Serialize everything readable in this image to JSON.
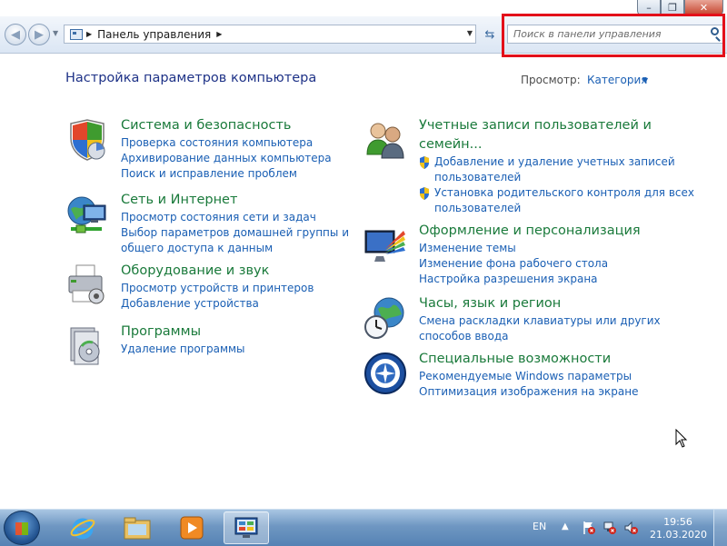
{
  "window": {
    "address_path": "Панель управления",
    "search_placeholder": "Поиск в панели управления",
    "caption_min": "–",
    "caption_max": "❐",
    "caption_close": "✕"
  },
  "header": {
    "title": "Настройка параметров компьютера",
    "view_label": "Просмотр:",
    "view_value": "Категория"
  },
  "categories_left": [
    {
      "icon": "shield-icon",
      "title": "Система и безопасность",
      "links": [
        "Проверка состояния компьютера",
        "Архивирование данных компьютера",
        "Поиск и исправление проблем"
      ]
    },
    {
      "icon": "network-globe-icon",
      "title": "Сеть и Интернет",
      "links": [
        "Просмотр состояния сети и задач",
        "Выбор параметров домашней группы и",
        "общего доступа к данным"
      ]
    },
    {
      "icon": "printer-icon",
      "title": "Оборудование и звук",
      "links": [
        "Просмотр устройств и принтеров",
        "Добавление устройства"
      ]
    },
    {
      "icon": "programs-icon",
      "title": "Программы",
      "links": [
        "Удаление программы"
      ]
    }
  ],
  "categories_right": [
    {
      "icon": "users-icon",
      "title_line1": "Учетные записи пользователей и",
      "title_line2": "семейн...",
      "links": [
        "Добавление и удаление учетных записей",
        "пользователей",
        "Установка родительского контроля для всех",
        "пользователей"
      ]
    },
    {
      "icon": "monitor-palette-icon",
      "title": "Оформление и персонализация",
      "links": [
        "Изменение темы",
        "Изменение фона рабочего стола",
        "Настройка разрешения экрана"
      ]
    },
    {
      "icon": "clock-globe-icon",
      "title": "Часы, язык и регион",
      "links": [
        "Смена раскладки клавиатуры или других",
        "способов ввода"
      ]
    },
    {
      "icon": "accessibility-icon",
      "title": "Специальные возможности",
      "links": [
        "Рекомендуемые Windows параметры",
        "Оптимизация изображения на экране"
      ]
    }
  ],
  "taskbar": {
    "apps": [
      "internet-explorer-icon",
      "explorer-folder-icon",
      "media-player-icon",
      "control-panel-icon"
    ],
    "language": "EN",
    "time": "19:56",
    "date": "21.03.2020"
  },
  "colors": {
    "title_blue": "#1e3287",
    "category_green": "#1a7a3b",
    "link_blue": "#1a5fb4",
    "highlight_red": "#e3101a"
  }
}
